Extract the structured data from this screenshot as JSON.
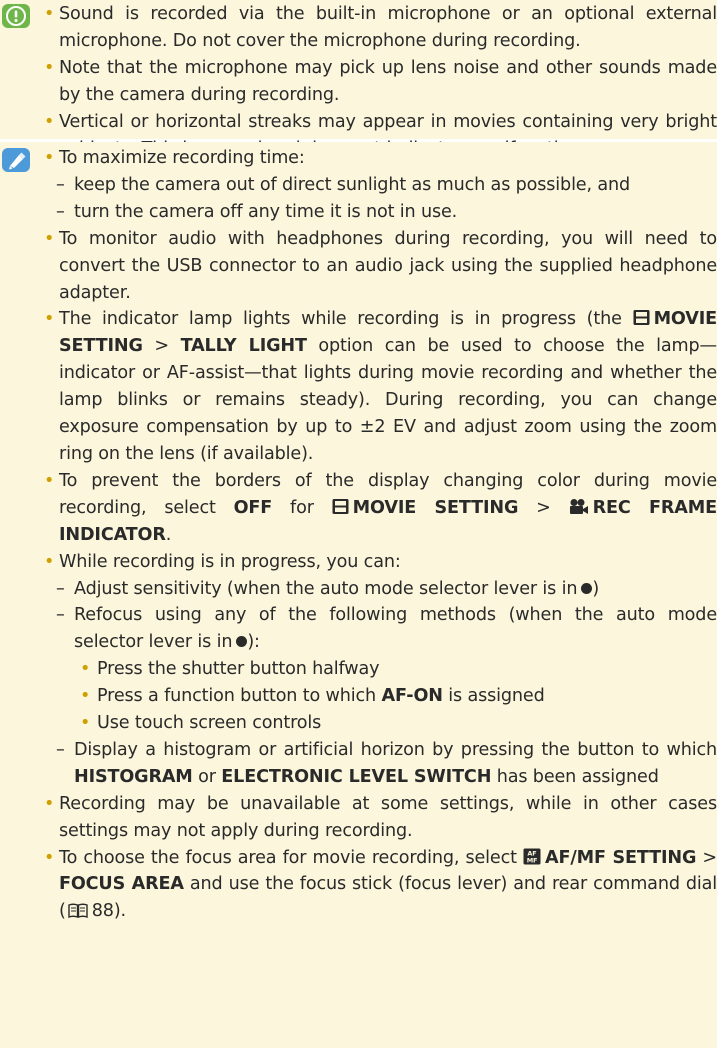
{
  "caution": {
    "icon": "caution-icon",
    "items": [
      "Sound is recorded via the built-in microphone or an optional external microphone.  Do not cover the microphone during recording.",
      "Note that the microphone may pick up lens noise and other sounds made by the camera during recording.",
      "Vertical or horizontal streaks may appear in movies containing very bright subjects. This is normal and does not indicate a malfunction."
    ]
  },
  "note": {
    "icon": "note-icon",
    "recording_time": {
      "lead": "To maximize recording time:",
      "subs": [
        "keep the camera out of direct sunlight as much as possible, and",
        "turn the camera off any time it is not in use."
      ]
    },
    "audio": "To monitor audio with headphones during recording, you will need to convert the USB connector to an audio jack using the supplied headphone adapter.",
    "tally": {
      "t1": "The indicator lamp lights while recording is in progress (the",
      "k1": "MOVIE SETTING",
      "t2": ">",
      "k2": "TALLY LIGHT",
      "t3": "option can be used to choose the lamp—indicator or AF-assist—that lights during movie recording and whether the lamp blinks or remains steady). During recording, you can change exposure compensation by up to ±2 EV and adjust zoom using the zoom ring on the lens (if available)."
    },
    "borders": {
      "t1": "To prevent the borders of the display changing color during movie recording, select",
      "k1": "OFF",
      "t2": "for",
      "k2": "MOVIE SETTING",
      "t3": ">",
      "k3": "REC FRAME INDICATOR",
      "t4": "."
    },
    "while_recording": {
      "lead": "While recording is in progress, you can:",
      "sensitivity": "Adjust sensitivity (when the auto mode selector lever is in",
      "refocus": "Refocus using any of the following methods (when the auto mode selector lever is in",
      "refocus_end": "):",
      "methods": {
        "m1": "Press the shutter button halfway",
        "m2a": "Press a function button to which",
        "m2k": "AF-ON",
        "m2b": "is assigned",
        "m3": "Use touch screen controls"
      },
      "histogram": {
        "t1": "Display a histogram or artificial horizon by pressing the button to which",
        "k1": "HISTOGRAM",
        "t2": "or",
        "k2": "ELECTRONIC LEVEL SWITCH",
        "t3": "has been assigned"
      }
    },
    "unavailable": "Recording may be unavailable at some settings, while in other cases settings may not apply during recording.",
    "focus_area": {
      "t1": "To choose the focus area for movie recording, select",
      "k1": "AF/MF SETTING",
      "t2": ">",
      "k2": "FOCUS AREA",
      "t3": "and use the focus stick (focus lever) and rear command dial (",
      "page_ref": "88",
      "t4": ")."
    }
  },
  "icons": {
    "movie_setting": "film-icon",
    "rec_frame": "movie-camera-icon",
    "af_mf": "af-mf-icon",
    "page_ref": "book-icon",
    "auto_mode": "auto-mode-dot-icon"
  },
  "colors": {
    "box_background": "#fbf6dc",
    "caution_icon": "#6fb64a",
    "note_icon": "#4c9ad8",
    "bullet": "#d0a000",
    "text": "#2a2a2a"
  }
}
